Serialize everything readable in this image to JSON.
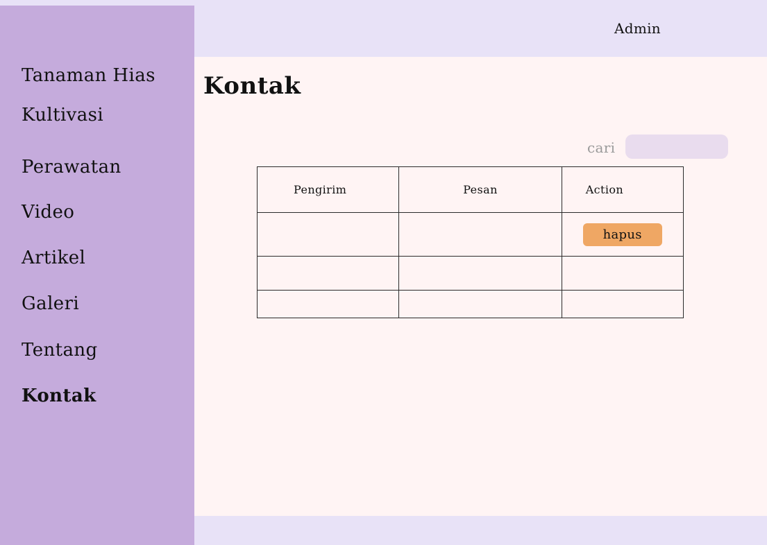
{
  "sidebar": {
    "items": [
      {
        "label": "Tanaman Hias"
      },
      {
        "label": "Kultivasi"
      },
      {
        "label": "Perawatan"
      },
      {
        "label": "Video"
      },
      {
        "label": "Artikel"
      },
      {
        "label": "Galeri"
      },
      {
        "label": "Tentang"
      },
      {
        "label": "Kontak"
      }
    ],
    "active": "Kontak"
  },
  "header": {
    "user_label": "Admin"
  },
  "main": {
    "title": "Kontak",
    "search": {
      "label": "cari",
      "value": "",
      "placeholder": ""
    },
    "table": {
      "columns": [
        "Pengirim",
        "Pesan",
        "Action"
      ],
      "rows": [
        {
          "sender": "",
          "message": "",
          "action": "hapus"
        },
        {
          "sender": "",
          "message": "",
          "action": ""
        },
        {
          "sender": "",
          "message": "",
          "action": ""
        }
      ]
    }
  },
  "colors": {
    "sidebar_bg": "#c5abdc",
    "header_bg": "#e8e2f7",
    "content_bg": "#fff4f4",
    "search_bg": "#e9dcee",
    "delete_button": "#efa764"
  },
  "icons": []
}
